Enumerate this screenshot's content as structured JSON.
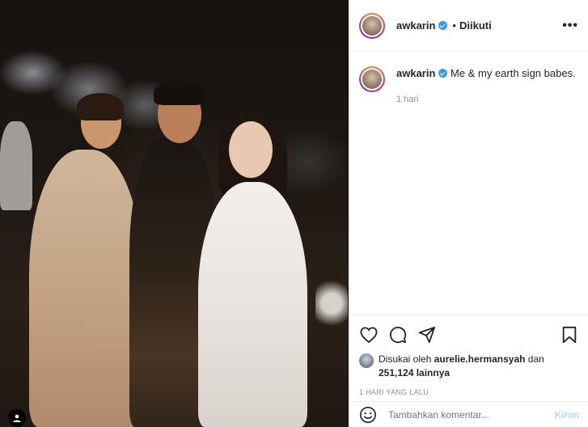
{
  "post": {
    "username": "awkarin",
    "follow_status": "Diikuti",
    "separator": "•",
    "more_label": "•••"
  },
  "caption": {
    "username": "awkarin",
    "text": "Me & my earth sign babes.",
    "time": "1 hari"
  },
  "likes": {
    "prefix": "Disukai oleh",
    "liker": "aurelie.hermansyah",
    "suffix_and": "dan",
    "count_text": "251,124 lainnya"
  },
  "posted_time": "1 HARI YANG LALU",
  "comment": {
    "placeholder": "Tambahkan komentar...",
    "send_label": "Kirim"
  },
  "colors": {
    "verified": "#3897f0",
    "muted": "#8e8e8e",
    "send_disabled": "#b3dbff"
  }
}
